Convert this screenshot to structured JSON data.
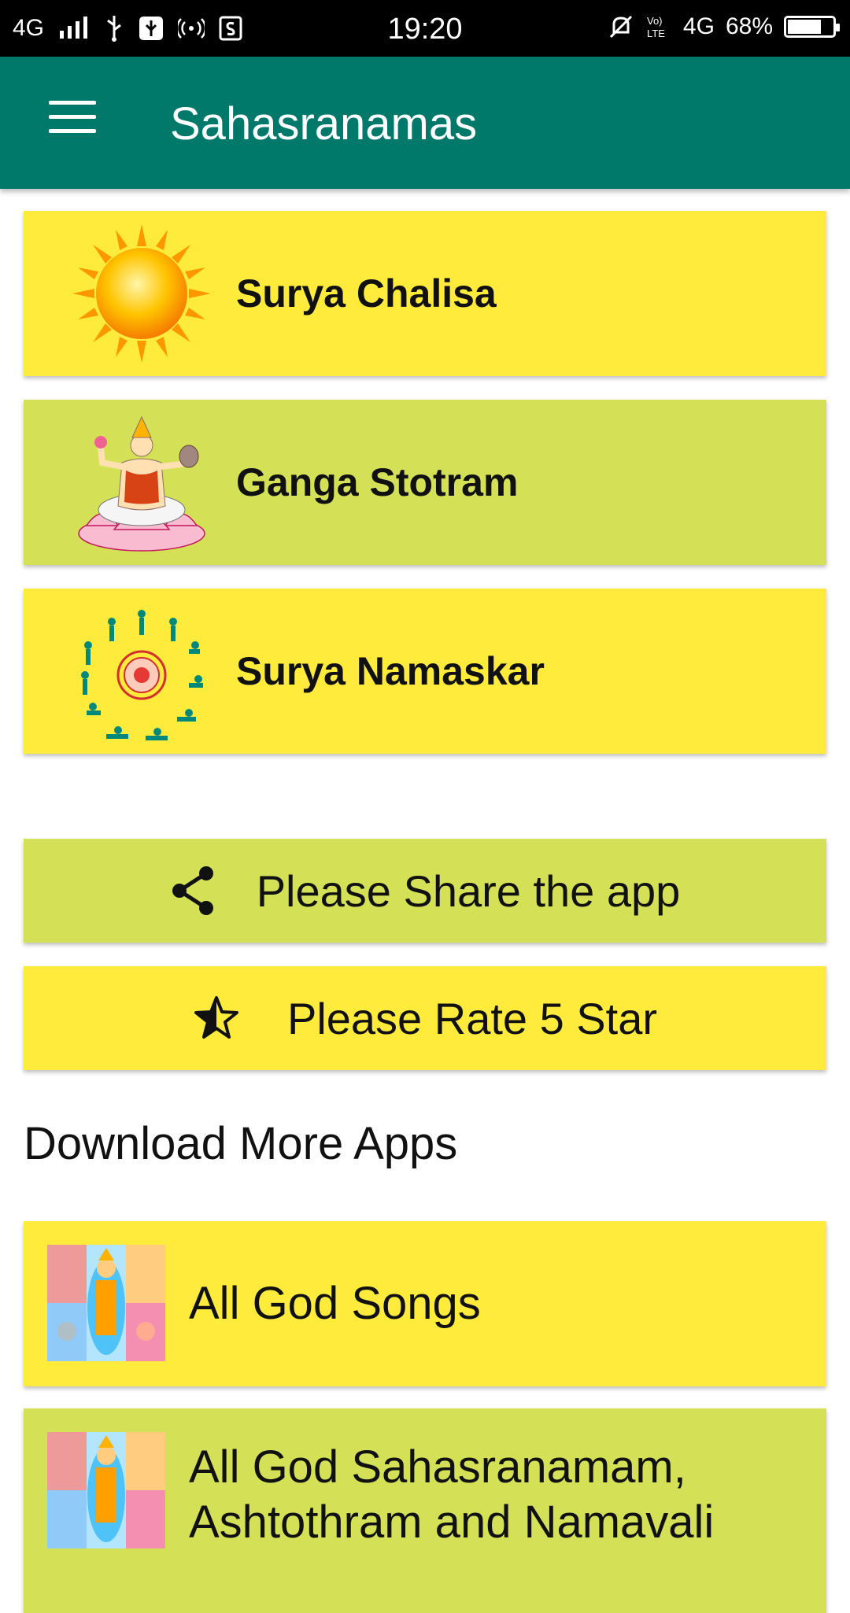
{
  "status_bar": {
    "network": "4G",
    "time": "19:20",
    "battery_percent": "68%",
    "lte_label": "4G"
  },
  "app_bar": {
    "title": "Sahasranamas"
  },
  "list_items": [
    {
      "label": "Surya Chalisa",
      "color": "#ffeb3b"
    },
    {
      "label": "Ganga Stotram",
      "color": "#d4e157"
    },
    {
      "label": "Surya Namaskar",
      "color": "#ffeb3b"
    }
  ],
  "actions": {
    "share_label": "Please Share the app",
    "rate_label": "Please Rate 5 Star"
  },
  "more_apps": {
    "title": "Download More Apps",
    "items": [
      {
        "label": "All God Songs"
      },
      {
        "label": "All God Sahasranamam, Ashtothram and Namavali"
      }
    ]
  },
  "colors": {
    "app_bar": "#00796b",
    "yellow_card": "#ffeb3b",
    "lime_card": "#d4e157"
  }
}
